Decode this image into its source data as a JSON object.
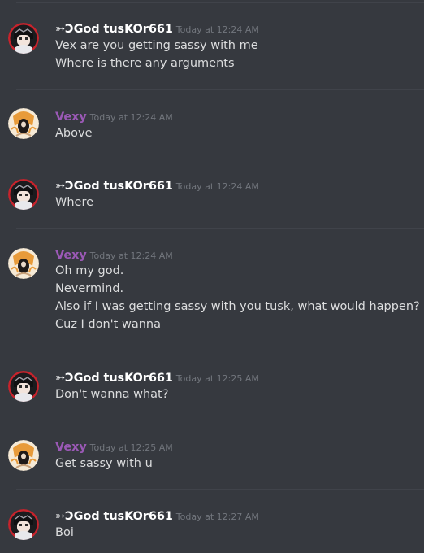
{
  "messages": [
    {
      "author": "tusk",
      "username": "➳ƆGod tusKOr661",
      "timestamp": "Today at 12:24 AM",
      "lines": [
        "Vex are you getting sassy with me",
        "Where is there any arguments"
      ]
    },
    {
      "author": "vexy",
      "username": "Vexy",
      "timestamp": "Today at 12:24 AM",
      "lines": [
        "Above"
      ]
    },
    {
      "author": "tusk",
      "username": "➳ƆGod tusKOr661",
      "timestamp": "Today at 12:24 AM",
      "lines": [
        "Where"
      ]
    },
    {
      "author": "vexy",
      "username": "Vexy",
      "timestamp": "Today at 12:24 AM",
      "lines": [
        "Oh my god.",
        "Nevermind.",
        "Also if I was getting sassy with you tusk, what would happen?",
        "Cuz I don't wanna"
      ]
    },
    {
      "author": "tusk",
      "username": "➳ƆGod tusKOr661",
      "timestamp": "Today at 12:25 AM",
      "lines": [
        "Don't wanna what?"
      ]
    },
    {
      "author": "vexy",
      "username": "Vexy",
      "timestamp": "Today at 12:25 AM",
      "lines": [
        "Get sassy with u"
      ]
    },
    {
      "author": "tusk",
      "username": "➳ƆGod tusKOr661",
      "timestamp": "Today at 12:27 AM",
      "lines": [
        "Boi"
      ]
    }
  ],
  "colors": {
    "background": "#36393f",
    "divider": "#40434a",
    "tusk_name": "#ffffff",
    "vexy_name": "#9b59b6",
    "timestamp": "#72767d",
    "message_text": "#dcddde"
  },
  "icons": {
    "tusk_avatar": "anime-character-avatar-icon",
    "vexy_avatar": "orange-character-avatar-icon"
  }
}
